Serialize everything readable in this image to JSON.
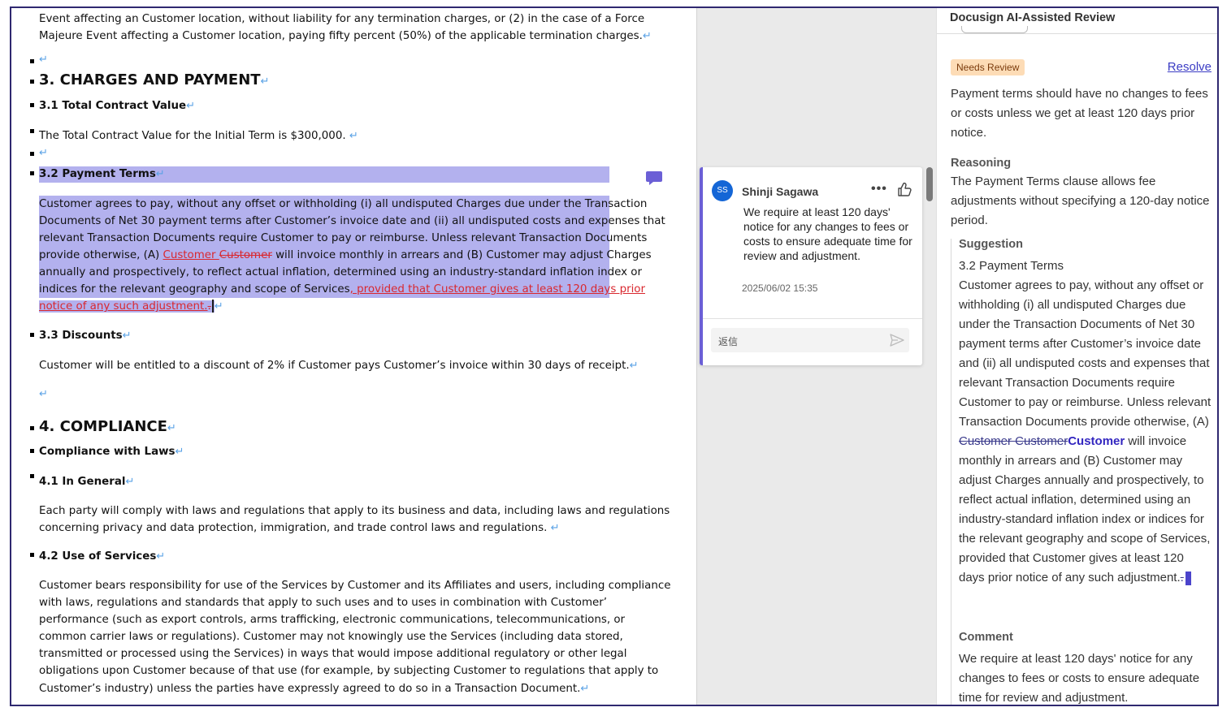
{
  "document": {
    "intro_line1": "Event affecting an Customer location, without liability for any termination charges, or (2) in the case of a Force",
    "intro_line2": "Majeure Event affecting a Customer location, paying fifty percent (50%) of the applicable termination charges.",
    "pilcrow": "↵",
    "sec3_heading": "3. CHARGES AND PAYMENT",
    "s31_heading": "3.1 Total Contract Value",
    "s31_text": "The Total Contract Value for the Initial Term is $300,000. ",
    "s32_heading": "3.2 Payment Terms",
    "s32_lines": [
      "Customer agrees to pay, without any offset or withholding (i) all undisputed Charges due under the Transaction",
      "Documents of Net 30 payment terms after Customer’s invoice date and (ii) all undisputed costs and expenses that",
      "relevant Transaction Documents require Customer to pay or reimburse.  Unless relevant Transaction Documents"
    ],
    "s32_line4_pre": "provide otherwise, (A) ",
    "s32_line4_ins": "Customer ",
    "s32_line4_del": "Customer",
    "s32_line4_post": " will invoice monthly in arrears and (B) Customer may adjust Charges",
    "s32_line5": "annually and prospectively, to reflect actual inflation, determined using an industry-standard inflation index or",
    "s32_line6_pre": "indices for the relevant geography and scope of Services",
    "s32_line6_ins": ", provided that Customer gives at least 120 days prior",
    "s32_line7_ins": "notice of any such adjustment.",
    "s32_line7_del": ".",
    "s33_heading": "3.3 Discounts",
    "s33_text": "Customer will be entitled to a discount of 2% if Customer pays Customer’s invoice within 30 days of receipt.",
    "sec4_heading": "4. COMPLIANCE",
    "s4_sub_heading": "Compliance with Laws",
    "s41_heading": "4.1 In General",
    "s41_lines": [
      "Each party will comply with laws and regulations that apply to its business and data, including laws and regulations",
      "concerning privacy and data protection, immigration, and trade control laws and regulations.  "
    ],
    "s42_heading": "4.2 Use of Services",
    "s42_lines": [
      "Customer bears responsibility for use of the Services by Customer and its Affiliates and users, including compliance",
      "with laws, regulations and standards that apply to such uses and to uses in combination with Customer’",
      "performance (such as export controls, arms trafficking, electronic communications, telecommunications, or",
      "common carrier laws or regulations).  Customer may not knowingly use the Services (including data stored,",
      "transmitted or processed using the Services) in ways that would impose additional regulatory or other legal",
      "obligations upon Customer because of that use (for example, by subjecting Customer to regulations that apply to",
      "Customer’s industry) unless the parties have expressly agreed to do so in a Transaction Document."
    ]
  },
  "comment": {
    "avatar_initials": "SS",
    "author": "Shinji Sagawa",
    "more": "•••",
    "text": "We require at least 120 days' notice for any changes to fees or costs to ensure adequate time for review and adjustment.",
    "date": "2025/06/02 15:35",
    "reply_placeholder": "返信"
  },
  "review_panel": {
    "title": "Docusign AI-Assisted Review",
    "status_badge": "Needs Review",
    "resolve_label": "Resolve",
    "summary": "Payment terms should have no changes to fees or costs unless we get at least 120 days prior notice.",
    "reasoning_label": "Reasoning",
    "reasoning_text": "The Payment Terms clause allows fee adjustments without specifying a 120-day notice period.",
    "suggestion_label": "Suggestion",
    "suggestion_title": "3.2 Payment Terms",
    "suggestion_pre": "Customer agrees to pay, without any offset or withholding (i) all undisputed Charges due under the Transaction Documents of Net 30 payment terms after Customer’s invoice date and (ii) all undisputed costs and expenses that relevant Transaction Documents require Customer to pay or reimburse.  Unless relevant Transaction Documents provide otherwise, (A) ",
    "suggestion_del": "Customer Customer",
    "suggestion_ins": "Customer",
    "suggestion_post": " will invoice monthly in arrears and (B) Customer may adjust Charges annually and prospectively, to reflect actual inflation, determined using an industry-standard inflation index or indices for the relevant geography and scope of Services, provided that Customer gives at least 120 days prior notice of any such adjustment.",
    "suggestion_del_tail": ".",
    "comment_label": "Comment",
    "comment_text": "We require at least 120 days' notice for any changes to fees or costs to ensure adequate time for review and adjustment."
  },
  "colors": {
    "selection": "#b3b1ee",
    "track_change": "#d9282f",
    "accent": "#6b5fd6",
    "avatar": "#1466d6",
    "badge_bg": "#fddcb6",
    "link": "#3b3cc4"
  }
}
